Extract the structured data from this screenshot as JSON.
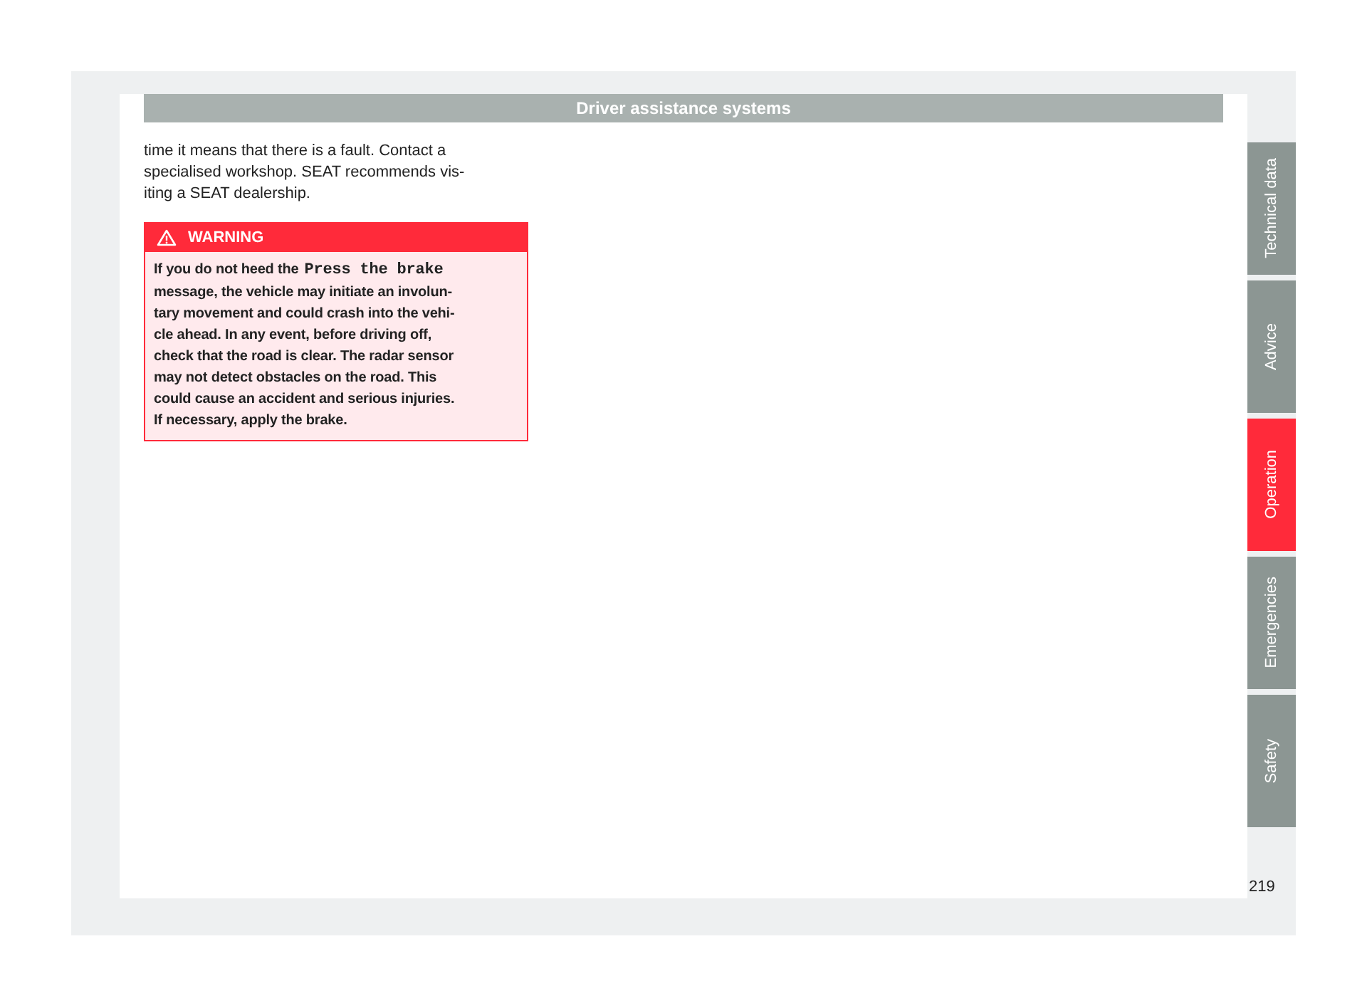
{
  "header": {
    "title": "Driver assistance systems"
  },
  "paragraph": {
    "lines": [
      "time it means that there is a fault. Contact a",
      "specialised workshop. SEAT recommends vis-",
      "iting a SEAT dealership."
    ]
  },
  "warning": {
    "label": "WARNING",
    "first_line": {
      "text": "If you do not heed the",
      "code": "Press the brake"
    },
    "lines": [
      "message, the vehicle may initiate an involun-",
      "tary movement and could crash into the vehi-",
      "cle ahead. In any event, before driving off,",
      "check that the road is clear. The radar sensor",
      "may not detect obstacles on the road. This",
      "could cause an accident and serious injuries.",
      "If necessary, apply the brake."
    ]
  },
  "side_tabs": [
    {
      "label": "Technical data",
      "selected": false
    },
    {
      "label": "Advice",
      "selected": false
    },
    {
      "label": "Operation",
      "selected": true
    },
    {
      "label": "Emergencies",
      "selected": false
    },
    {
      "label": "Safety",
      "selected": false
    }
  ],
  "page_number": "219"
}
